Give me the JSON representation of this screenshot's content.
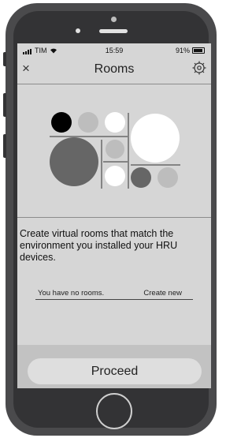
{
  "status_bar": {
    "carrier": "TIM",
    "time": "15:59",
    "battery": "91%"
  },
  "header": {
    "close_label": "×",
    "title": "Rooms"
  },
  "content": {
    "description": "Create virtual rooms that match the environment you installed your HRU devices.",
    "no_rooms_text": "You have no rooms.",
    "create_new_label": "Create new"
  },
  "footer": {
    "proceed_label": "Proceed"
  },
  "colors": {
    "screen_bg": "#d6d6d6",
    "footer_bg": "#c2c2c2",
    "button_bg": "#dedede",
    "circle_black": "#000000",
    "circle_dark": "#666666",
    "circle_light": "#bdbdbd",
    "circle_white": "#ffffff"
  },
  "icons": {
    "close": "close-icon",
    "settings": "gear-icon",
    "signal": "signal-icon",
    "wifi": "wifi-icon",
    "battery": "battery-icon"
  }
}
